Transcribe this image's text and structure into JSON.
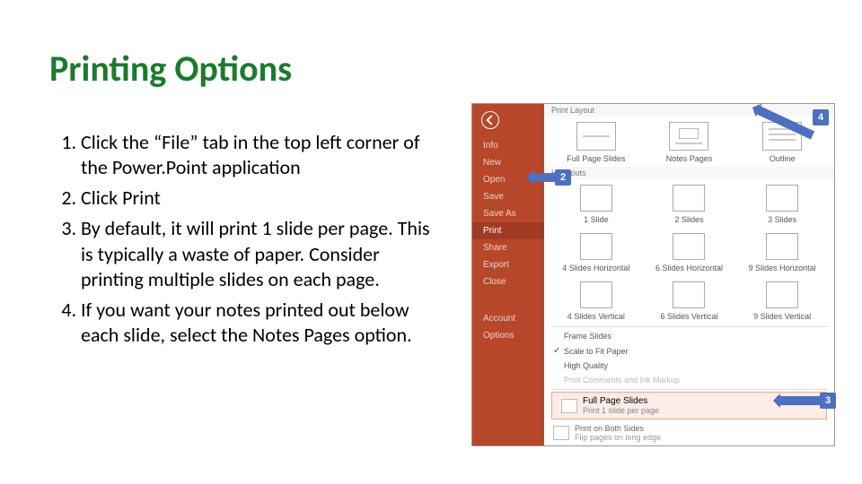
{
  "title": "Printing Options",
  "steps": [
    "Click the “File” tab in the top left corner of the Power.Point application",
    "Click Print",
    "By default, it will print 1 slide per page. This is typically a waste of paper. Consider printing multiple slides on each page.",
    "If you want your notes printed out below each slide, select the Notes Pages option."
  ],
  "shot": {
    "sidebar": {
      "items": [
        "Info",
        "New",
        "Open",
        "Save",
        "Save As",
        "Print",
        "Share",
        "Export",
        "Close"
      ],
      "footer": [
        "Account",
        "Options"
      ],
      "selected": "Print"
    },
    "layout": {
      "header": "Print Layout",
      "items": [
        "Full Page Slides",
        "Notes Pages",
        "Outline"
      ]
    },
    "handouts": {
      "header": "Handouts",
      "row1": [
        "1 Slide",
        "2 Slides",
        "3 Slides"
      ],
      "row2": [
        "4 Slides Horizontal",
        "6 Slides Horizontal",
        "9 Slides Horizontal"
      ],
      "row3": [
        "4 Slides Vertical",
        "6 Slides Vertical",
        "9 Slides Vertical"
      ]
    },
    "options": {
      "frame": "Frame Slides",
      "scale": "Scale to Fit Paper",
      "hq": "High Quality",
      "comments": "Print Comments and Ink Markup"
    },
    "selection": {
      "title": "Full Page Slides",
      "subtitle": "Print 1 slide per page"
    },
    "bottom": {
      "title": "Print on Both Sides",
      "subtitle": "Flip pages on long edge"
    },
    "callouts": {
      "c2": "2",
      "c3": "3",
      "c4": "4"
    }
  }
}
